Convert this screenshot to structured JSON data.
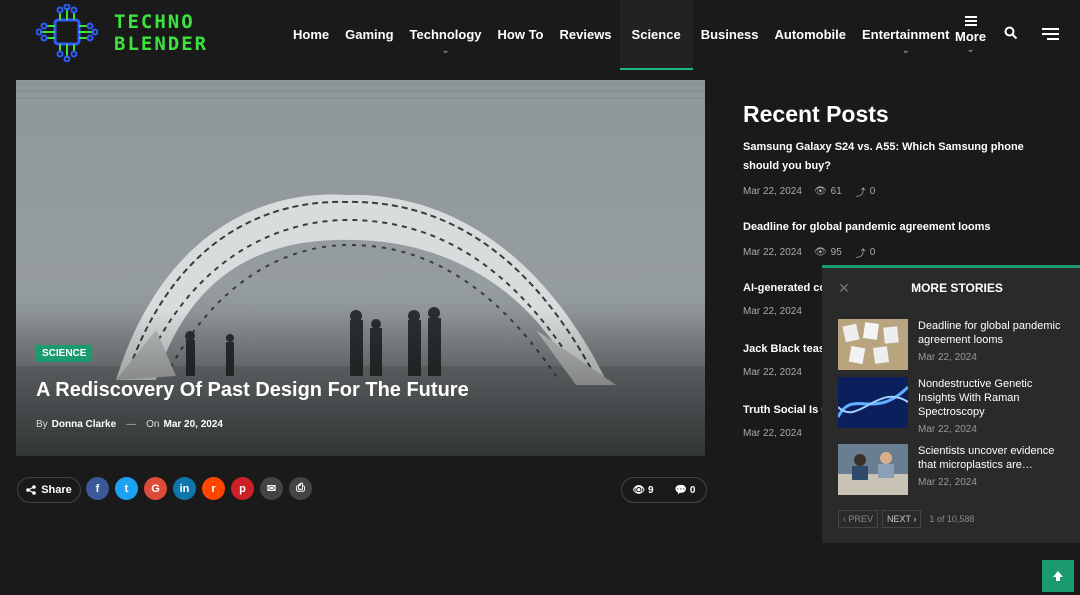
{
  "brand": {
    "line1": "TECHNO",
    "line2": "BLENDER"
  },
  "nav": {
    "items": [
      {
        "label": "Home",
        "has_submenu": false
      },
      {
        "label": "Gaming",
        "has_submenu": false
      },
      {
        "label": "Technology",
        "has_submenu": true
      },
      {
        "label": "How To",
        "has_submenu": false
      },
      {
        "label": "Reviews",
        "has_submenu": false
      },
      {
        "label": "Science",
        "has_submenu": false,
        "active": true
      },
      {
        "label": "Business",
        "has_submenu": false
      },
      {
        "label": "Automobile",
        "has_submenu": false
      },
      {
        "label": "Entertainment",
        "has_submenu": true
      }
    ],
    "more_label": "More",
    "icons": {
      "search": "search-icon",
      "menu": "hamburger-menu-icon",
      "more": "list-icon"
    }
  },
  "hero": {
    "category": "SCIENCE",
    "title": "A Rediscovery Of Past Design For The Future",
    "by_label": "By",
    "author": "Donna Clarke",
    "on_label": "On",
    "date": "Mar 20, 2024"
  },
  "share": {
    "label": "Share",
    "networks": [
      {
        "name": "facebook",
        "glyph": "f",
        "color": "#3b5998"
      },
      {
        "name": "twitter",
        "glyph": "t",
        "color": "#1da1f2"
      },
      {
        "name": "google",
        "glyph": "G",
        "color": "#dd4b39"
      },
      {
        "name": "linkedin",
        "glyph": "in",
        "color": "#0e76a8"
      },
      {
        "name": "reddit",
        "glyph": "r",
        "color": "#ff4500"
      },
      {
        "name": "pinterest",
        "glyph": "p",
        "color": "#cb2027"
      },
      {
        "name": "email",
        "glyph": "✉",
        "color": "#444444"
      },
      {
        "name": "print",
        "glyph": "⎙",
        "color": "#444444"
      }
    ],
    "views": "9",
    "comments": "0"
  },
  "recent": {
    "title": "Recent Posts",
    "posts": [
      {
        "title": "Samsung Galaxy S24 vs. A55: Which Samsung phone should you buy?",
        "date": "Mar 22, 2024",
        "views": "61",
        "shares": "0"
      },
      {
        "title": "Deadline for global pandemic agreement looms",
        "date": "Mar 22, 2024",
        "views": "95",
        "shares": "0"
      },
      {
        "title": "AI-generated co",
        "date": "Mar 22, 2024"
      },
      {
        "title": "Jack Black teas",
        "date": "Mar 22, 2024"
      },
      {
        "title": "Truth Social Is C",
        "date": "Mar 22, 2024"
      }
    ]
  },
  "more_stories": {
    "title": "MORE STORIES",
    "close_glyph": "✕",
    "items": [
      {
        "title": "Deadline for global pandemic agreement looms",
        "date": "Mar 22, 2024"
      },
      {
        "title": "Nondestructive Genetic Insights With Raman Spectroscopy",
        "date": "Mar 22, 2024"
      },
      {
        "title": "Scientists uncover evidence that microplastics are…",
        "date": "Mar 22, 2024"
      }
    ],
    "prev": "‹ PREV",
    "next": "NEXT ›",
    "count": "1 of 10,588"
  },
  "colors": {
    "accent": "#1a9a6e",
    "brand_green": "#3de33d",
    "background": "#1a1a1a"
  }
}
